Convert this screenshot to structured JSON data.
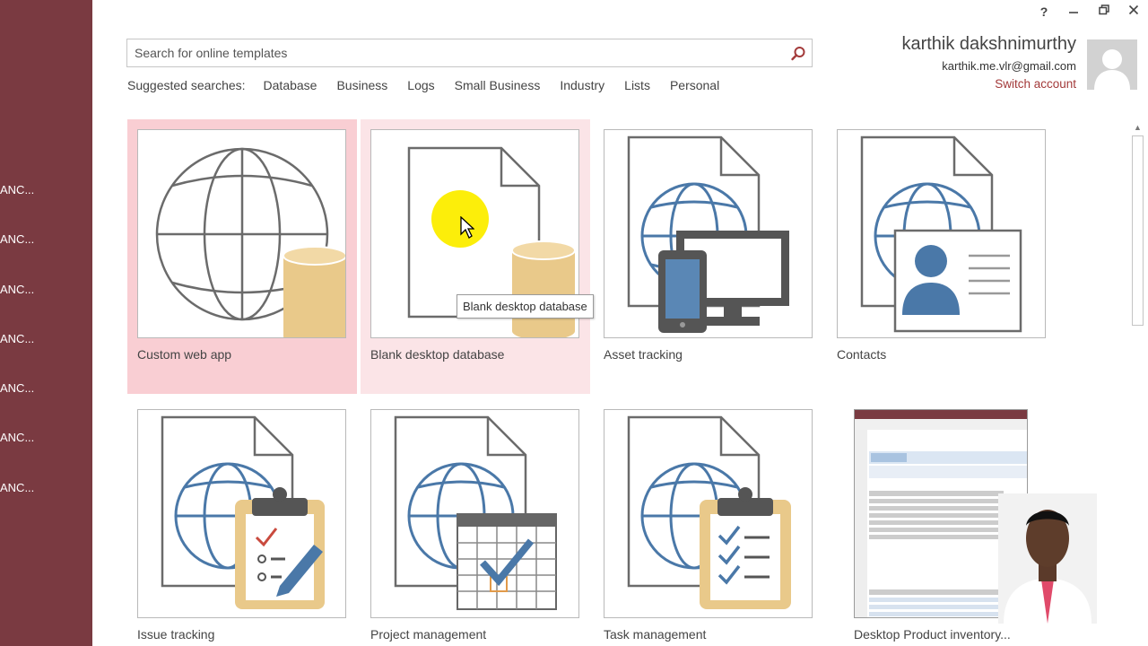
{
  "sidebar": {
    "background": "#7a3a41",
    "recent": [
      {
        "label": "ANC..."
      },
      {
        "label": "ANC..."
      },
      {
        "label": "ANC..."
      },
      {
        "label": "ANC..."
      },
      {
        "label": "ANC..."
      },
      {
        "label": "ANC..."
      },
      {
        "label": "ANC..."
      }
    ]
  },
  "window_controls": {
    "help": "?",
    "minimize": "—",
    "restore": "🗗",
    "close": "✕"
  },
  "search": {
    "placeholder": "Search for online templates",
    "icon": "search-icon"
  },
  "suggested": {
    "label": "Suggested searches:",
    "links": [
      "Database",
      "Business",
      "Logs",
      "Small Business",
      "Industry",
      "Lists",
      "Personal"
    ]
  },
  "account": {
    "name": "karthik dakshnimurthy",
    "email": "karthik.me.vlr@gmail.com",
    "switch_label": "Switch account",
    "accent": "#a33a3a"
  },
  "templates": [
    {
      "label": "Custom web app",
      "icon": "globe-database-icon",
      "state": "hover"
    },
    {
      "label": "Blank desktop database",
      "icon": "document-database-icon",
      "state": "hover-light"
    },
    {
      "label": "Asset tracking",
      "icon": "asset-devices-icon",
      "state": "normal"
    },
    {
      "label": "Contacts",
      "icon": "contact-card-icon",
      "state": "normal"
    },
    {
      "label": "Issue tracking",
      "icon": "issue-clipboard-icon",
      "state": "normal"
    },
    {
      "label": "Project management",
      "icon": "calendar-check-icon",
      "state": "normal"
    },
    {
      "label": "Task management",
      "icon": "task-clipboard-icon",
      "state": "normal"
    },
    {
      "label": "Desktop Product inventory...",
      "icon": "inventory-screenshot-icon",
      "state": "normal"
    }
  ],
  "tooltip": {
    "text": "Blank desktop database"
  },
  "colors": {
    "tile_hover": "#f9ced3",
    "tile_hover_light": "#fbe4e7",
    "icon_blue": "#4a78a8",
    "icon_gold": "#e9c98a",
    "icon_grey": "#666666"
  }
}
